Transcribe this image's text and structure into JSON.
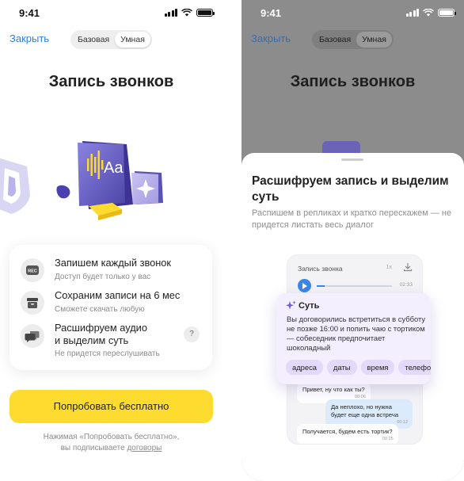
{
  "status": {
    "time": "9:41"
  },
  "nav": {
    "close": "Закрыть",
    "tabs": [
      "Базовая",
      "Умная"
    ],
    "active_tab": 1
  },
  "screen": {
    "title": "Запись звонков",
    "features": [
      {
        "icon": "rec-icon",
        "icon_text": "REC",
        "title": "Запишем каждый звонок",
        "subtitle": "Доступ будет только у вас"
      },
      {
        "icon": "storage-box-icon",
        "title": "Сохраним записи на 6 мес",
        "subtitle": "Сможете скачать любую"
      },
      {
        "icon": "chat-bubbles-icon",
        "title": "Расшифруем аудио\nи выделим суть",
        "subtitle": "Не придется переслушивать",
        "help": "?"
      }
    ],
    "cta": "Попробовать бесплатно",
    "legal_prefix": "Нажимая «Попробовать бесплатно»,",
    "legal_middle": "вы подписываете ",
    "legal_link": "договоры"
  },
  "sheet": {
    "title": "Расшифруем запись и выделим суть",
    "subtitle": "Распишем в репликах и кратко перескажем — не придется листать весь диалог",
    "preview": {
      "header": "Запись звонка",
      "speed": "1x",
      "duration": "02:33",
      "summary_title": "Суть",
      "summary_text": "Вы договорились встретиться в субботу не позже 16:00 и попить чаю с тортиком — собеседник предпочитает шоколадный",
      "chips": [
        "адреса",
        "даты",
        "время",
        "телефоны"
      ],
      "messages": [
        {
          "side": "left",
          "text": "Привет, ну что как ты?",
          "time": "00:06"
        },
        {
          "side": "right",
          "text": "Да неплохо, но нужна будет еще одна встреча",
          "time": "00:12"
        },
        {
          "side": "left",
          "text": "Получается, будем есть тортик?",
          "time": "00:25"
        }
      ]
    }
  },
  "colors": {
    "accent_blue": "#2d7fdb",
    "cta_yellow": "#fddb2f",
    "purple": "#6b63b5",
    "summary_bg": "#f4efff"
  }
}
